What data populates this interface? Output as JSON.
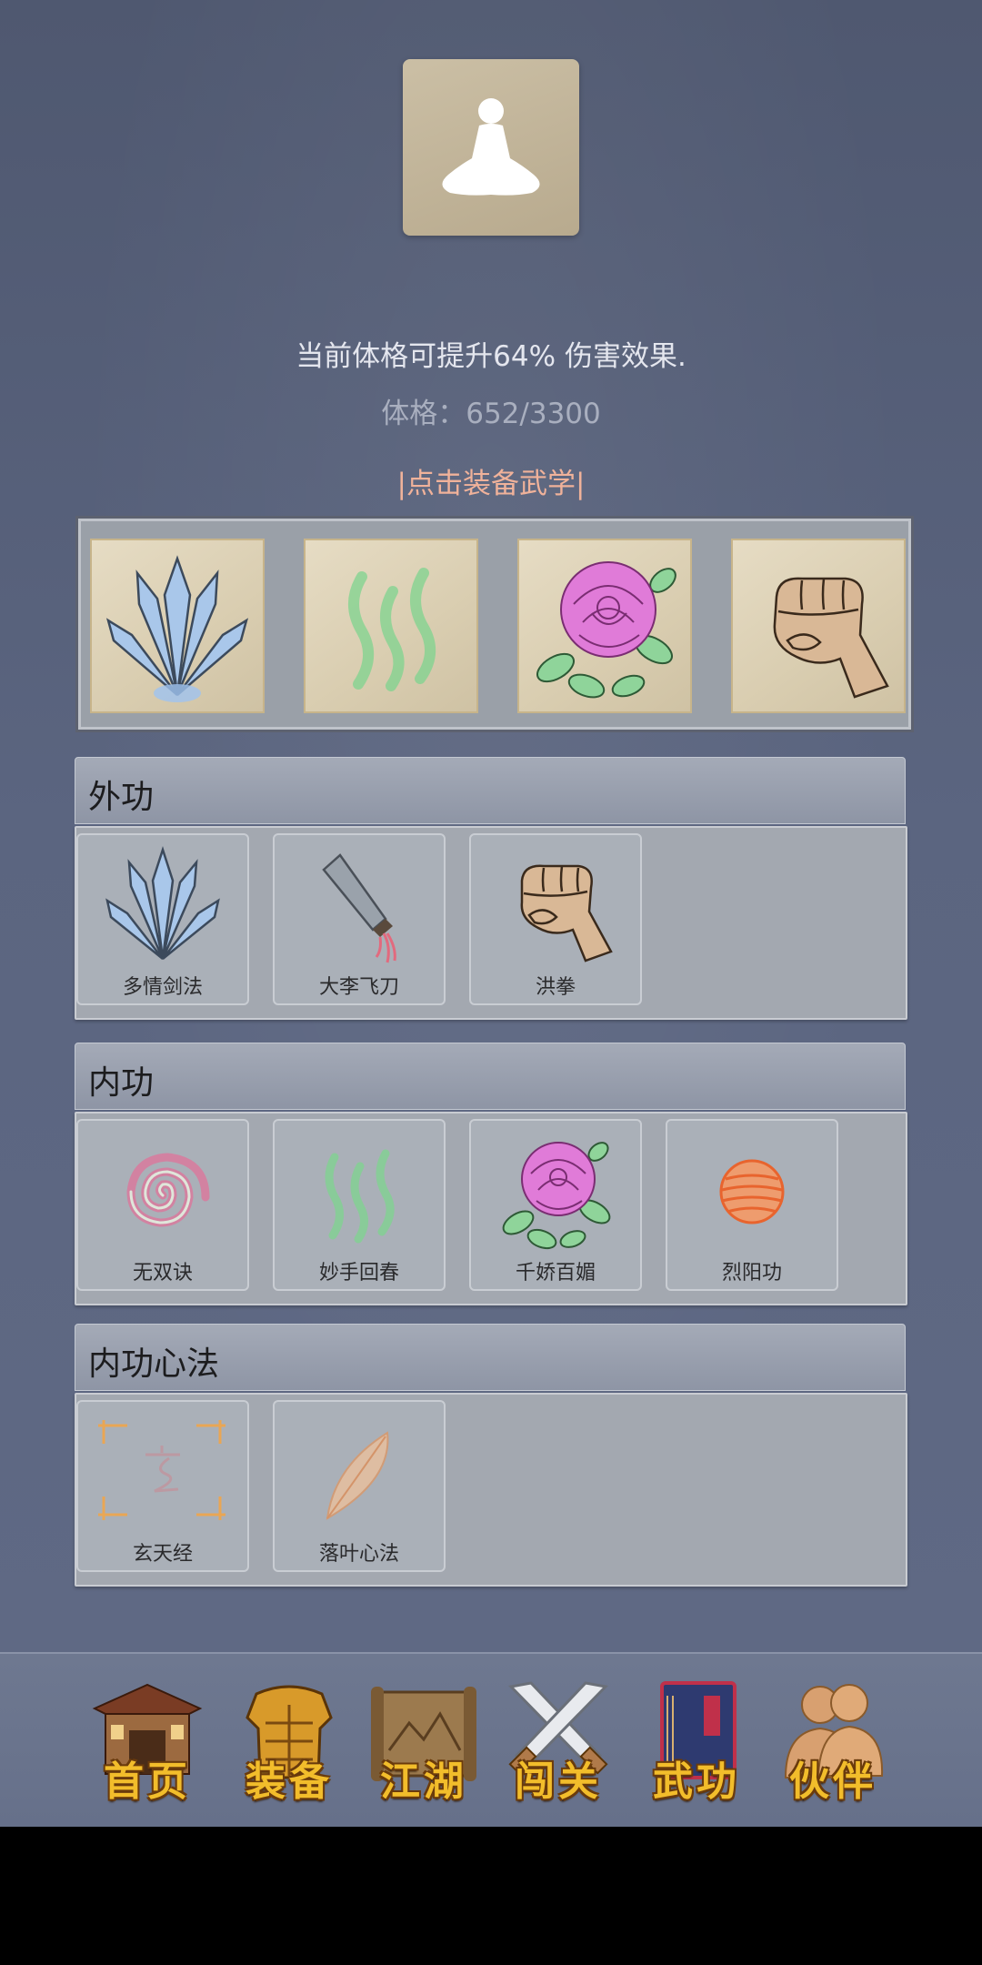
{
  "header": {
    "bonus_text": "当前体格可提升64% 伤害效果.",
    "stat_text": "体格：652/3300",
    "equip_link": "|点击装备武学|",
    "avatar_icon": "meditation-icon"
  },
  "equipped": [
    {
      "icon": "sword-fan-icon"
    },
    {
      "icon": "green-wisps-icon"
    },
    {
      "icon": "rose-icon"
    },
    {
      "icon": "fist-icon"
    }
  ],
  "categories": [
    {
      "title": "外功",
      "skills": [
        {
          "label": "多情剑法",
          "icon": "sword-fan-icon"
        },
        {
          "label": "大李飞刀",
          "icon": "flying-knife-icon"
        },
        {
          "label": "洪拳",
          "icon": "fist-icon"
        }
      ]
    },
    {
      "title": "内功",
      "skills": [
        {
          "label": "无双诀",
          "icon": "spiral-icon"
        },
        {
          "label": "妙手回春",
          "icon": "green-wisps-icon"
        },
        {
          "label": "千娇百媚",
          "icon": "rose-icon"
        },
        {
          "label": "烈阳功",
          "icon": "sun-orb-icon"
        }
      ]
    },
    {
      "title": "内功心法",
      "skills": [
        {
          "label": "玄天经",
          "icon": "xuan-seal-icon"
        },
        {
          "label": "落叶心法",
          "icon": "leaf-icon"
        }
      ]
    }
  ],
  "nav": [
    {
      "label": "首页",
      "icon": "house-icon"
    },
    {
      "label": "装备",
      "icon": "armor-icon"
    },
    {
      "label": "江湖",
      "icon": "scroll-map-icon"
    },
    {
      "label": "闯关",
      "icon": "crossed-swords-icon"
    },
    {
      "label": "武功",
      "icon": "book-icon"
    },
    {
      "label": "伙伴",
      "icon": "companions-icon"
    }
  ],
  "colors": {
    "link": "#f0b29a",
    "nav_label": "#f2bd2b",
    "panel": "#a3a8b0"
  }
}
